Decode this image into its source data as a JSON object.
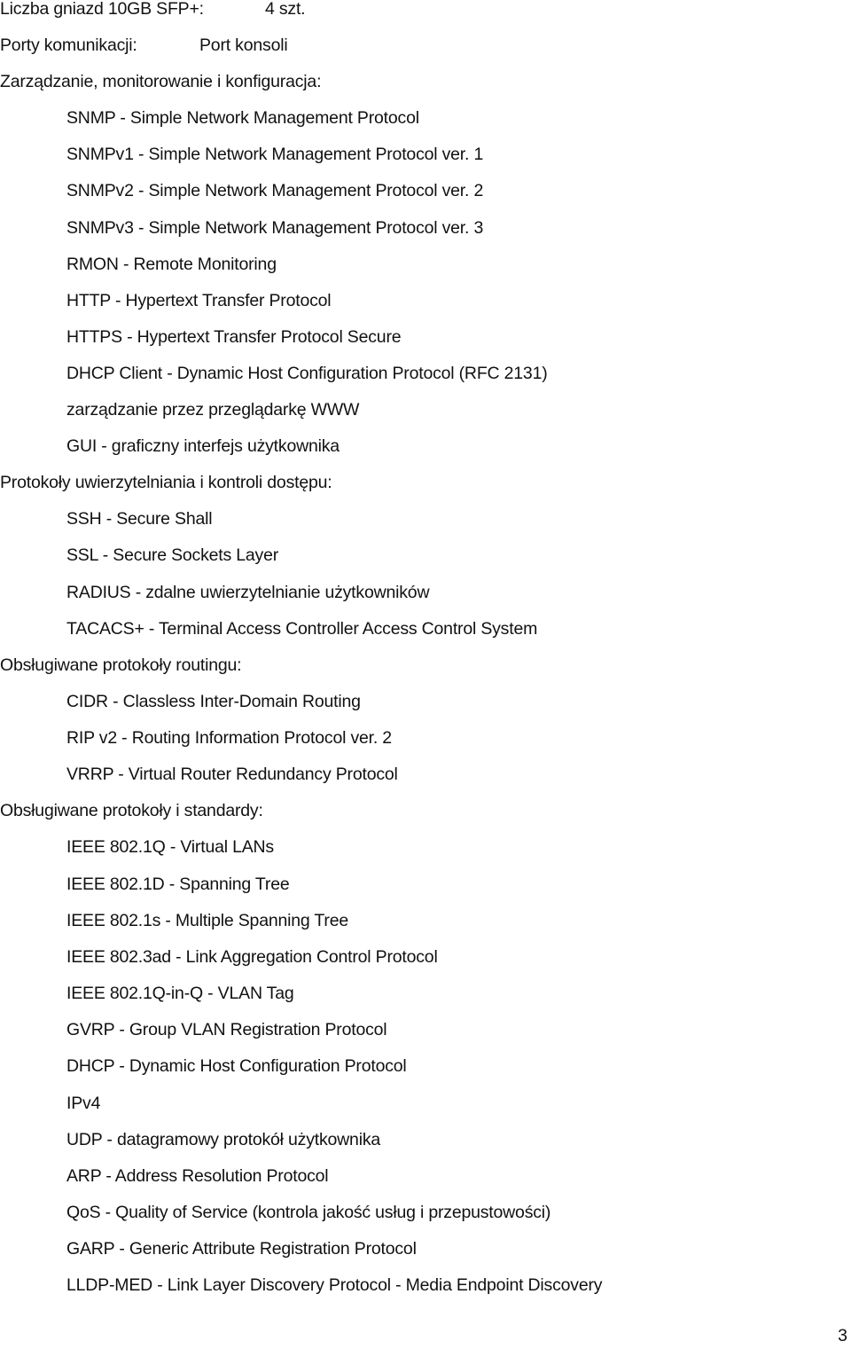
{
  "document": {
    "spec_rows": [
      {
        "label": "Liczba gniazd 10GB SFP+:",
        "value": "4 szt."
      },
      {
        "label": "Porty komunikacji:",
        "value": "Port konsoli"
      }
    ],
    "sections": [
      {
        "heading": "Zarządzanie, monitorowanie i konfiguracja:",
        "items": [
          "SNMP - Simple Network Management Protocol",
          "SNMPv1 - Simple Network Management Protocol ver. 1",
          "SNMPv2 - Simple Network Management Protocol ver. 2",
          "SNMPv3 - Simple Network Management Protocol ver. 3",
          "RMON - Remote Monitoring",
          "HTTP - Hypertext Transfer Protocol",
          "HTTPS - Hypertext Transfer Protocol Secure",
          "DHCP Client - Dynamic Host Configuration Protocol (RFC 2131)",
          "zarządzanie przez przeglądarkę WWW",
          "GUI - graficzny interfejs użytkownika"
        ]
      },
      {
        "heading": "Protokoły uwierzytelniania i kontroli dostępu:",
        "items": [
          "SSH - Secure Shall",
          "SSL - Secure Sockets Layer",
          "RADIUS - zdalne uwierzytelnianie użytkowników",
          "TACACS+ - Terminal Access Controller Access Control System"
        ]
      },
      {
        "heading": "Obsługiwane protokoły routingu:",
        "items": [
          "CIDR - Classless Inter-Domain Routing",
          "RIP v2 - Routing Information Protocol ver. 2",
          "VRRP - Virtual Router Redundancy Protocol"
        ]
      },
      {
        "heading": "Obsługiwane protokoły i standardy:",
        "items": [
          "IEEE 802.1Q - Virtual LANs",
          "IEEE 802.1D - Spanning Tree",
          "IEEE 802.1s - Multiple Spanning Tree",
          "IEEE 802.3ad - Link Aggregation Control Protocol",
          "IEEE 802.1Q-in-Q - VLAN Tag",
          "GVRP - Group VLAN Registration Protocol",
          "DHCP - Dynamic Host Configuration Protocol",
          "IPv4",
          "UDP - datagramowy protokół użytkownika",
          "ARP - Address Resolution Protocol",
          "QoS - Quality of Service (kontrola jakość usług i przepustowości)",
          "GARP - Generic Attribute Registration Protocol",
          "LLDP-MED - Link Layer Discovery Protocol - Media Endpoint Discovery"
        ]
      }
    ],
    "page_number": "3"
  }
}
